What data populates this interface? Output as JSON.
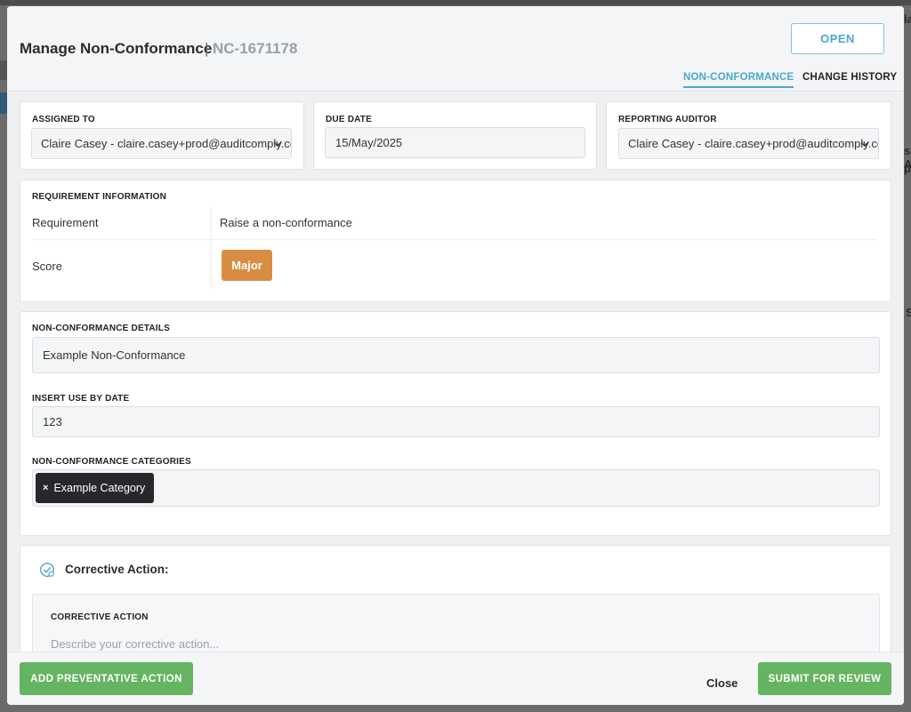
{
  "background_hints": {
    "right_top": "la",
    "right_mid1": "s A",
    "right_mid2": "po",
    "right_low": "S"
  },
  "modal": {
    "title": "Manage Non-Conformance",
    "separator": "|",
    "record_id": "NC-1671178",
    "status_label": "OPEN",
    "tabs": [
      {
        "label": "NON-CONFORMANCE",
        "active": true
      },
      {
        "label": "CHANGE HISTORY",
        "active": false
      }
    ]
  },
  "assigned_to": {
    "label": "ASSIGNED TO",
    "value": "Claire Casey - claire.casey+prod@auditcomply.com"
  },
  "due_date": {
    "label": "DUE DATE",
    "value": "15/May/2025"
  },
  "reporting_auditor": {
    "label": "REPORTING AUDITOR",
    "value": "Claire Casey - claire.casey+prod@auditcomply.com"
  },
  "requirement_info": {
    "heading": "REQUIREMENT INFORMATION",
    "requirement_label": "Requirement",
    "requirement_value": "Raise a non-conformance",
    "score_label": "Score",
    "score_value": "Major"
  },
  "details": {
    "details_label": "NON-CONFORMANCE DETAILS",
    "details_value": "Example Non-Conformance",
    "use_by_label": "INSERT USE BY DATE",
    "use_by_value": "123",
    "categories_label": "NON-CONFORMANCE CATEGORIES",
    "categories": [
      {
        "remove": "×",
        "label": "Example Category"
      }
    ]
  },
  "corrective_action": {
    "section_title": "Corrective Action:",
    "field_label": "CORRECTIVE ACTION",
    "placeholder": "Describe your corrective action..."
  },
  "footer": {
    "add_preventative_label": "ADD PREVENTATIVE ACTION",
    "close_label": "Close",
    "submit_label": "SUBMIT FOR REVIEW"
  },
  "colors": {
    "accent_blue": "#4aa8cf",
    "score_major": "#d98d43",
    "primary_green": "#65b462",
    "chip_dark": "#27282c"
  }
}
